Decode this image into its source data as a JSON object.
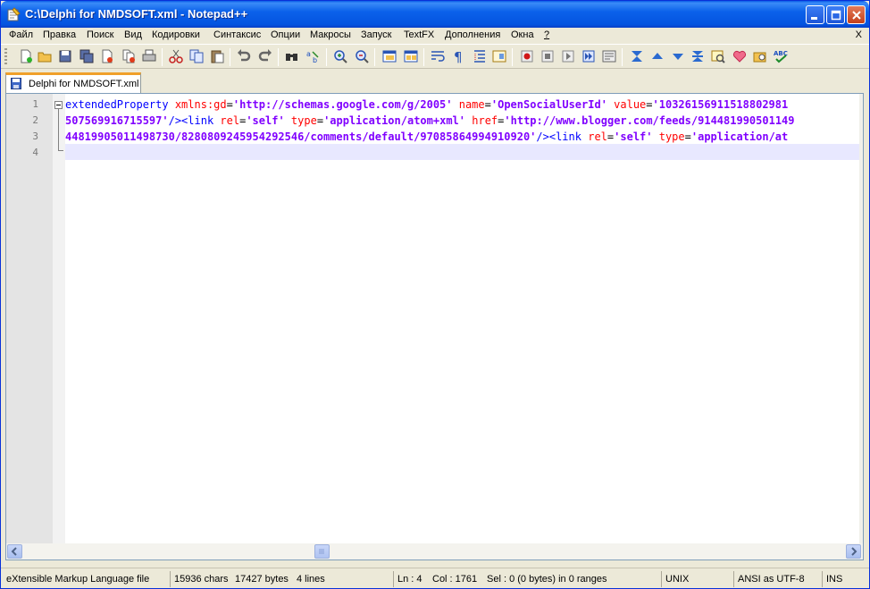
{
  "window": {
    "title": "C:\\Delphi for NMDSOFT.xml - Notepad++"
  },
  "menu": {
    "items": [
      "Файл",
      "Правка",
      "Поиск",
      "Вид",
      "Кодировки",
      "Синтаксис",
      "Опции",
      "Макросы",
      "Запуск",
      "TextFX",
      "Дополнения",
      "Окна",
      "?"
    ],
    "close": "X"
  },
  "toolbar": {
    "icons": [
      "new-file-icon",
      "open-file-icon",
      "save-icon",
      "save-all-icon",
      "close-icon",
      "close-all-icon",
      "print-icon",
      "cut-icon",
      "copy-icon",
      "paste-icon",
      "undo-icon",
      "redo-icon",
      "find-icon",
      "replace-icon",
      "zoom-in-icon",
      "zoom-out-icon",
      "sync-v-icon",
      "sync-h-icon",
      "word-wrap-icon",
      "show-all-chars-icon",
      "indent-guide-icon",
      "doc-map-icon",
      "record-macro-icon",
      "stop-macro-icon",
      "play-macro-icon",
      "run-macro-multiple-icon",
      "save-macro-icon",
      "collapse-icon",
      "up-icon",
      "down-icon",
      "expand-icon",
      "highlight-icon",
      "heart-icon",
      "plugin-icon",
      "spellcheck-icon"
    ]
  },
  "tabs": [
    {
      "label": "Delphi for NMDSOFT.xml",
      "active": true
    }
  ],
  "editor": {
    "line_numbers": [
      "1",
      "2",
      "3",
      "4"
    ],
    "lines": [
      [
        {
          "t": "tag",
          "v": "extendedProperty"
        },
        {
          "t": "txt",
          "v": " "
        },
        {
          "t": "attr",
          "v": "xmlns:gd"
        },
        {
          "t": "eq",
          "v": "="
        },
        {
          "t": "val",
          "v": "'http://schemas.google.com/g/2005'"
        },
        {
          "t": "txt",
          "v": " "
        },
        {
          "t": "attr",
          "v": "name"
        },
        {
          "t": "eq",
          "v": "="
        },
        {
          "t": "val",
          "v": "'OpenSocialUserId'"
        },
        {
          "t": "txt",
          "v": " "
        },
        {
          "t": "attr",
          "v": "value"
        },
        {
          "t": "eq",
          "v": "="
        },
        {
          "t": "val",
          "v": "'10326156911518802981"
        }
      ],
      [
        {
          "t": "val",
          "v": "507569916715597'"
        },
        {
          "t": "tag",
          "v": "/><link"
        },
        {
          "t": "txt",
          "v": " "
        },
        {
          "t": "attr",
          "v": "rel"
        },
        {
          "t": "eq",
          "v": "="
        },
        {
          "t": "val",
          "v": "'self'"
        },
        {
          "t": "txt",
          "v": " "
        },
        {
          "t": "attr",
          "v": "type"
        },
        {
          "t": "eq",
          "v": "="
        },
        {
          "t": "val",
          "v": "'application/atom+xml'"
        },
        {
          "t": "txt",
          "v": " "
        },
        {
          "t": "attr",
          "v": "href"
        },
        {
          "t": "eq",
          "v": "="
        },
        {
          "t": "val",
          "v": "'http://www.blogger.com/feeds/914481990501149"
        }
      ],
      [
        {
          "t": "val",
          "v": "44819905011498730/8280809245954292546/comments/default/97085864994910920'"
        },
        {
          "t": "tag",
          "v": "/><link"
        },
        {
          "t": "txt",
          "v": " "
        },
        {
          "t": "attr",
          "v": "rel"
        },
        {
          "t": "eq",
          "v": "="
        },
        {
          "t": "val",
          "v": "'self'"
        },
        {
          "t": "txt",
          "v": " "
        },
        {
          "t": "attr",
          "v": "type"
        },
        {
          "t": "eq",
          "v": "="
        },
        {
          "t": "val",
          "v": "'application/at"
        }
      ],
      []
    ]
  },
  "statusbar": {
    "filetype": "eXtensible Markup Language file",
    "chars": "15936 chars",
    "bytes": "17427 bytes",
    "lines": "4 lines",
    "ln": "Ln : 4",
    "col": "Col : 1761",
    "sel": "Sel : 0 (0 bytes) in 0 ranges",
    "eol": "UNIX",
    "encoding": "ANSI as UTF-8",
    "mode": "INS"
  },
  "colors": {
    "tag": "#0000ff",
    "attr": "#ff0000",
    "value": "#8000ff",
    "current_line": "#e8e8ff",
    "title_bar": "#0b61ea",
    "tab_accent": "#f0a02a"
  }
}
